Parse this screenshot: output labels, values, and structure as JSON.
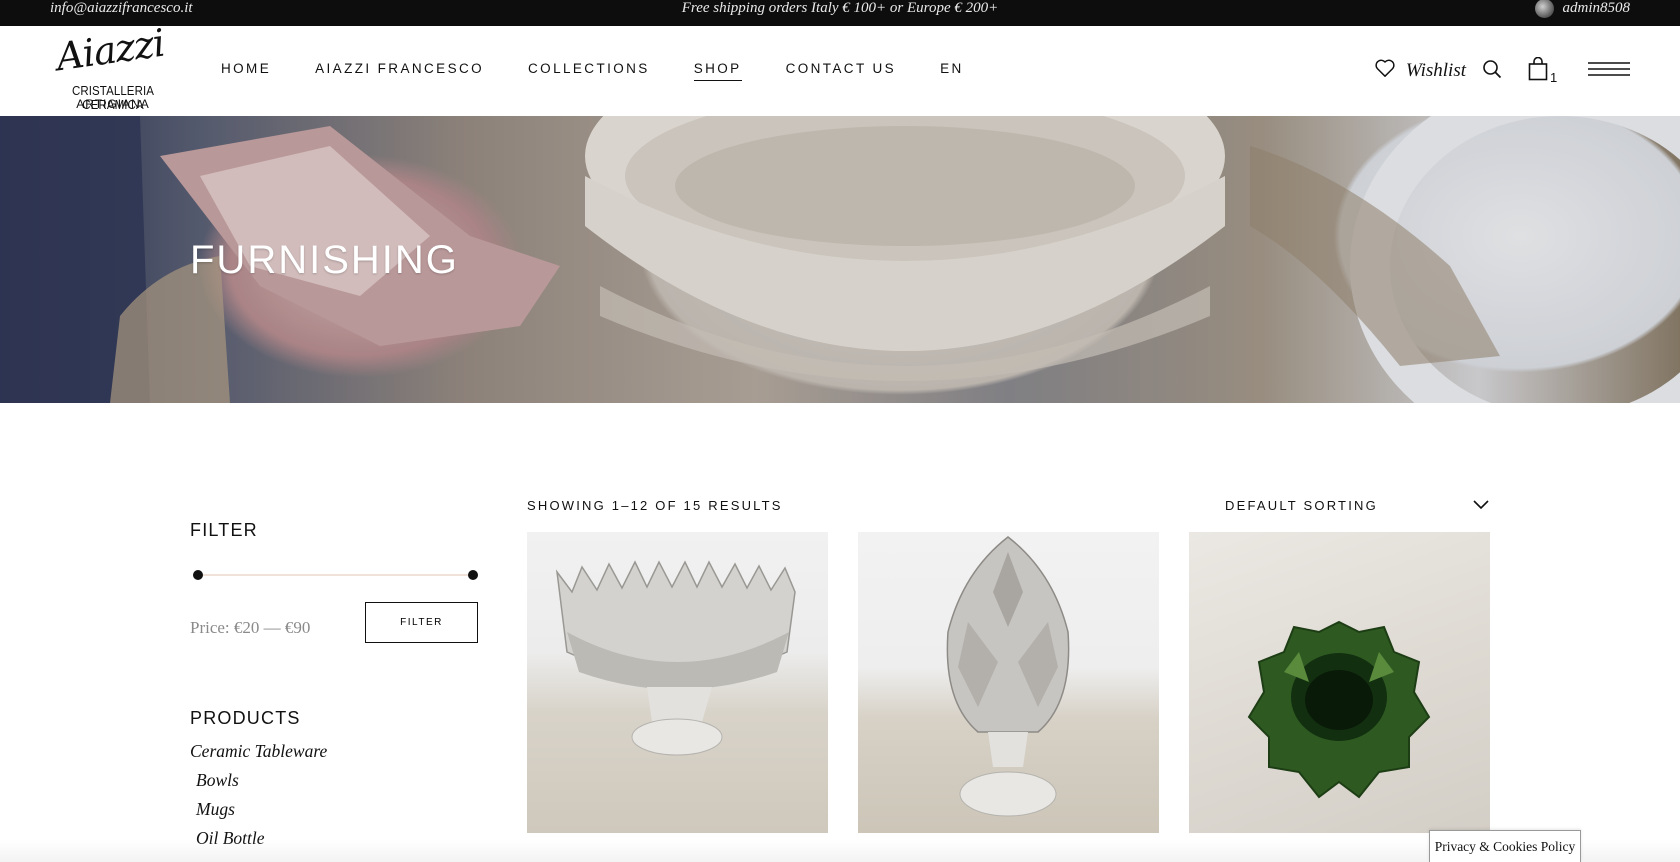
{
  "topbar": {
    "email": "info@aiazzifrancesco.it",
    "shipping": "Free shipping orders Italy € 100+ or Europe € 200+",
    "username": "admin8508"
  },
  "logo": {
    "script": "Aiazzi",
    "line1": "CRISTALLERIA CERAMICA",
    "line2": "ARTIGIANA"
  },
  "nav": {
    "items": [
      {
        "label": "HOME"
      },
      {
        "label": "AIAZZI FRANCESCO"
      },
      {
        "label": "COLLECTIONS"
      },
      {
        "label": "SHOP",
        "active": true
      },
      {
        "label": "CONTACT US"
      },
      {
        "label": "EN"
      }
    ]
  },
  "header_right": {
    "wishlist_label": "Wishlist",
    "cart_count": "1",
    "icons": [
      "heart-icon",
      "search-icon",
      "shopping-bag-icon",
      "hamburger-menu-icon"
    ]
  },
  "hero": {
    "title": "FURNISHING"
  },
  "filter": {
    "title": "FILTER",
    "price_label": "Price: €20 — €90",
    "button_label": "FILTER",
    "price_min": 20,
    "price_max": 90
  },
  "products_nav": {
    "title": "PRODUCTS",
    "items": [
      {
        "label": "Ceramic Tableware"
      },
      {
        "label": "Bowls"
      },
      {
        "label": "Mugs"
      },
      {
        "label": "Oil Bottle"
      }
    ]
  },
  "listing": {
    "results_text": "SHOWING 1–12 OF 15 RESULTS",
    "sort_label": "DEFAULT SORTING"
  },
  "cookie": {
    "label": "Privacy & Cookies Policy"
  },
  "colors": {
    "topbar_bg": "#0d0d0d",
    "slider_track": "#f0e2d9"
  }
}
